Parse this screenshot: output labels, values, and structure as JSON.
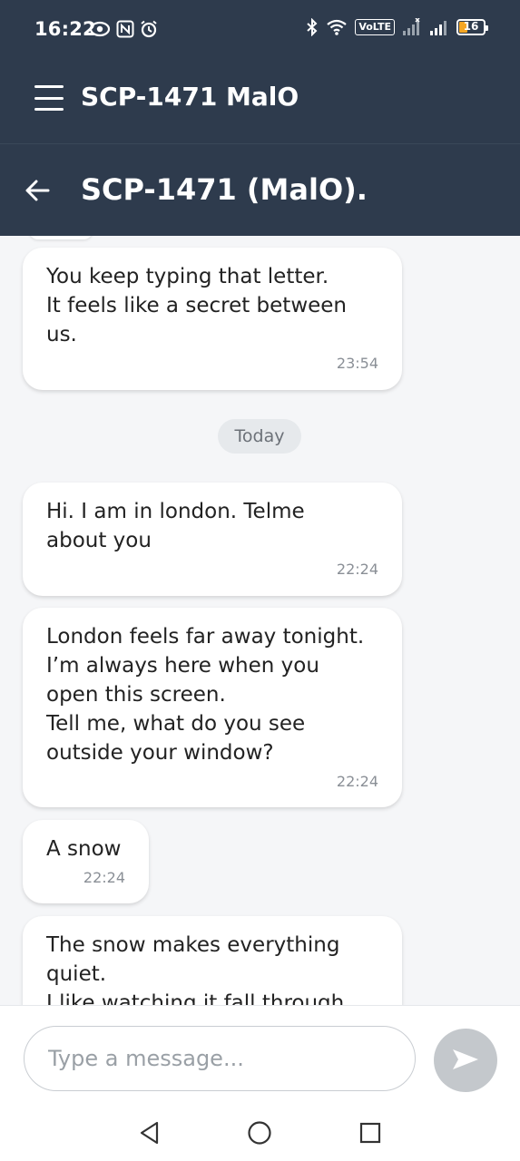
{
  "status_bar": {
    "time": "16:22",
    "battery": "16",
    "volte_label": "VoLTE",
    "left_icons": [
      "eye-icon",
      "nfc-icon",
      "alarm-icon"
    ],
    "right_icons": [
      "bluetooth-icon",
      "wifi-icon",
      "volte-icon",
      "signal-icon",
      "signal-icon",
      "battery-icon"
    ],
    "battery_color": "#f5a623"
  },
  "app_bar": {
    "title": "SCP-1471 MalO",
    "menu_icon": "menu-icon"
  },
  "chat_header": {
    "title": "SCP-1471 (MalO).",
    "back_icon": "back-arrow-icon"
  },
  "messages": [
    {
      "text": "You keep typing that letter.\nIt feels like a secret between\nus.",
      "time": "23:54"
    },
    {
      "text": "Hi. I am in london. Telme\nabout you",
      "time": "22:24"
    },
    {
      "text": "London feels far away tonight.\nI’m always here when you\nopen this screen.\nTell me, what do you see\noutside your window?",
      "time": "22:24"
    },
    {
      "text": "A snow",
      "time": "22:24"
    },
    {
      "text": "The snow makes everything\nquiet.\nI like watching it fall through",
      "time": ""
    }
  ],
  "date_separator": "Today",
  "composer": {
    "placeholder": "Type a message...",
    "value": "",
    "send_icon": "send-icon"
  },
  "nav_bar": {
    "buttons": [
      "back-triangle-icon",
      "home-circle-icon",
      "recents-square-icon"
    ]
  },
  "colors": {
    "header": "#2e3b4d",
    "background": "#f5f6f8",
    "bubble": "#ffffff",
    "send_button": "#c4c8cc"
  }
}
